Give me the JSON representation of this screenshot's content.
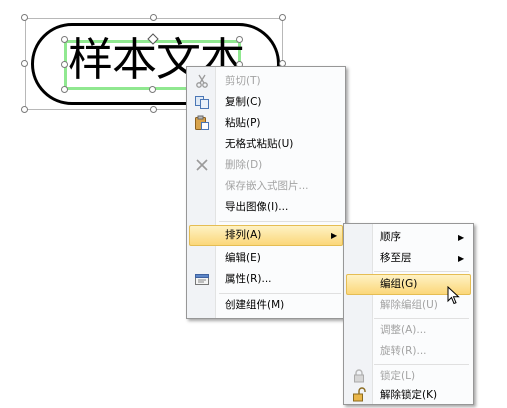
{
  "canvas": {
    "sample_text": "样本文本"
  },
  "context_menu": {
    "items": [
      {
        "label": "剪切(T)",
        "enabled": false,
        "icon": "scissors-icon"
      },
      {
        "label": "复制(C)",
        "enabled": true,
        "icon": "copy-icon"
      },
      {
        "label": "粘贴(P)",
        "enabled": true,
        "icon": "paste-icon"
      },
      {
        "label": "无格式粘贴(U)",
        "enabled": true
      },
      {
        "label": "删除(D)",
        "enabled": false,
        "icon": "delete-x-icon"
      },
      {
        "label": "保存嵌入式图片...",
        "enabled": false
      },
      {
        "label": "导出图像(I)...",
        "enabled": true
      },
      {
        "label": "排列(A)",
        "enabled": true,
        "highlighted": true,
        "submenu": true
      },
      {
        "label": "编辑(E)",
        "enabled": true
      },
      {
        "label": "属性(R)...",
        "enabled": true,
        "icon": "properties-icon"
      },
      {
        "label": "创建组件(M)",
        "enabled": true
      }
    ]
  },
  "submenu": {
    "items": [
      {
        "label": "顺序",
        "enabled": true,
        "submenu": true
      },
      {
        "label": "移至层",
        "enabled": true,
        "submenu": true
      },
      {
        "label": "编组(G)",
        "enabled": true,
        "highlighted": true
      },
      {
        "label": "解除编组(U)",
        "enabled": false
      },
      {
        "label": "调整(A)...",
        "enabled": false
      },
      {
        "label": "旋转(R)...",
        "enabled": false
      },
      {
        "label": "锁定(L)",
        "enabled": false,
        "icon": "lock-icon"
      },
      {
        "label": "解除锁定(K)",
        "enabled": true,
        "icon": "unlock-icon"
      }
    ]
  },
  "cursor": {
    "icon": "arrow-cursor-icon"
  }
}
